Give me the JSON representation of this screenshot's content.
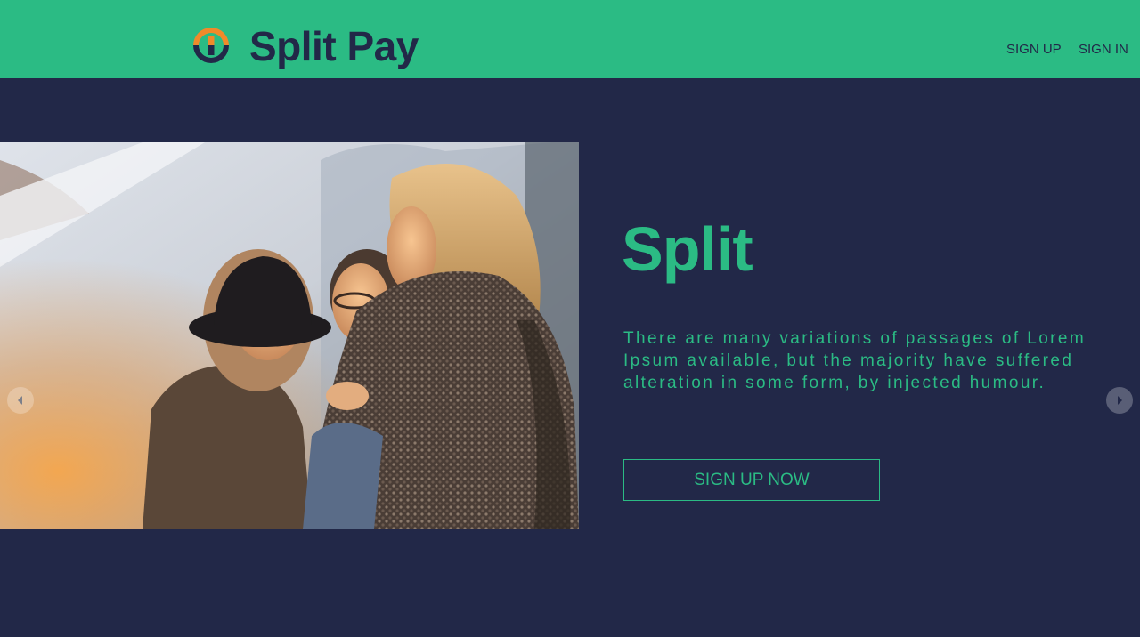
{
  "header": {
    "brand": "Split Pay",
    "nav": {
      "sign_up": "SIGN UP",
      "sign_in": "SIGN IN"
    },
    "logo_icon": "split-pay-logo-icon"
  },
  "hero": {
    "image_description": "Photo of three smiling women outdoors",
    "headline": "Split",
    "description": "There are many variations of passages of Lorem Ipsum available, but the majority have suffered alteration in some form, by injected humour.",
    "cta_label": "SIGN UP NOW",
    "carousel": {
      "prev_icon": "chevron-left-icon",
      "next_icon": "chevron-right-icon"
    }
  },
  "colors": {
    "accent_green": "#2bbb84",
    "navy": "#222848",
    "logo_orange": "#f08a2a"
  }
}
